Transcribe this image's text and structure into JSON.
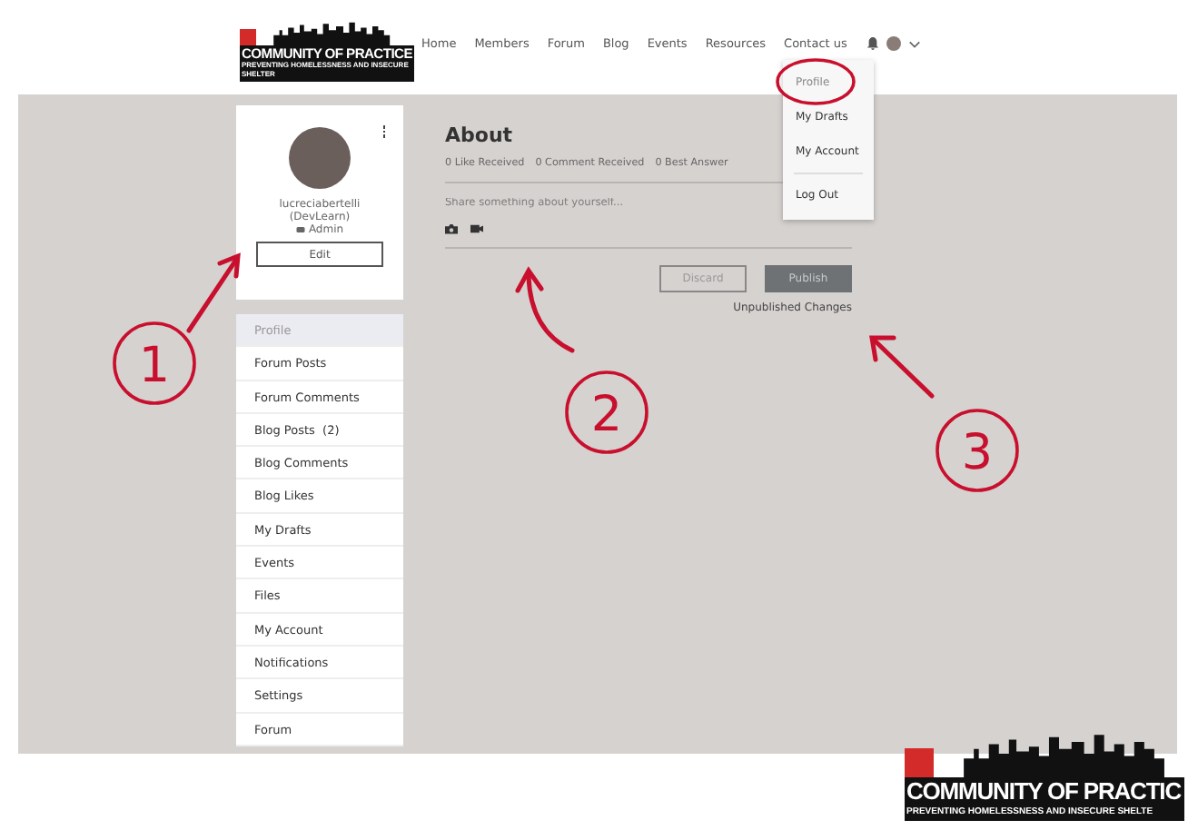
{
  "header": {
    "logo": {
      "title": "COMMUNITY OF PRACTICE",
      "subtitle": "PREVENTING HOMELESSNESS AND INSECURE SHELTER"
    },
    "nav": [
      {
        "label": "Home"
      },
      {
        "label": "Members"
      },
      {
        "label": "Forum"
      },
      {
        "label": "Blog"
      },
      {
        "label": "Events"
      },
      {
        "label": "Resources"
      },
      {
        "label": "Contact us"
      }
    ]
  },
  "account_menu": {
    "expanded": true,
    "items": [
      {
        "label": "Profile",
        "selected": true
      },
      {
        "label": "My Drafts",
        "selected": false
      },
      {
        "label": "My Account",
        "selected": false
      },
      {
        "label": "Log Out",
        "selected": false
      }
    ]
  },
  "profile_card": {
    "username": "lucreciabertelli",
    "organization": "(DevLearn)",
    "role": "Admin",
    "edit_button": "Edit"
  },
  "sidebar": {
    "items": [
      {
        "label": "Profile",
        "selected": true
      },
      {
        "label": "Forum Posts",
        "selected": false
      },
      {
        "label": "Forum Comments",
        "selected": false
      },
      {
        "label": "Blog Posts",
        "count": "(2)",
        "selected": false
      },
      {
        "label": "Blog Comments",
        "selected": false
      },
      {
        "label": "Blog Likes",
        "selected": false
      },
      {
        "label": "My Drafts",
        "selected": false
      },
      {
        "label": "Events",
        "selected": false
      },
      {
        "label": "Files",
        "selected": false
      },
      {
        "label": "My Account",
        "selected": false
      },
      {
        "label": "Notifications",
        "selected": false
      },
      {
        "label": "Settings",
        "selected": false
      },
      {
        "label": "Forum",
        "selected": false
      }
    ]
  },
  "about": {
    "title": "About",
    "stats": [
      "0 Like Received",
      "0 Comment Received",
      "0 Best Answer"
    ],
    "placeholder": "Share something about yourself...",
    "buttons": [
      {
        "label": "Discard",
        "kind": "secondary"
      },
      {
        "label": "Publish",
        "kind": "primary"
      }
    ],
    "status": "Unpublished Changes"
  },
  "annotations": [
    {
      "label": "1"
    },
    {
      "label": "2"
    },
    {
      "label": "3"
    }
  ],
  "footer_logo": {
    "title": "COMMUNITY OF PRACTIC",
    "subtitle": "PREVENTING HOMELESSNESS AND INSECURE SHELTE"
  }
}
